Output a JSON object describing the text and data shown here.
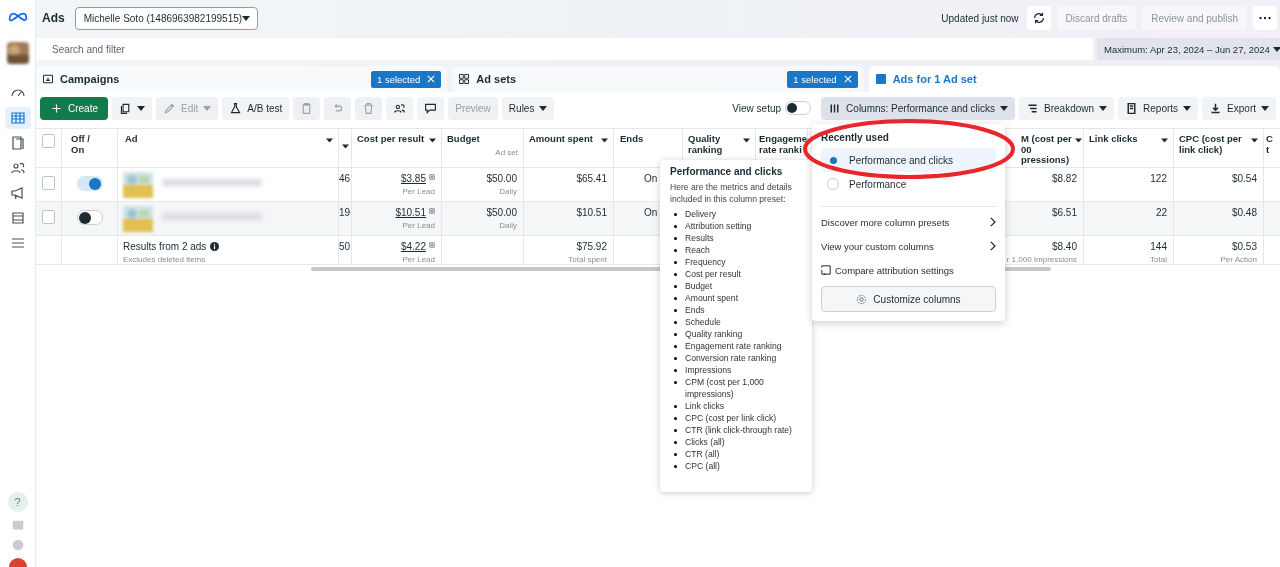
{
  "sidebar": {
    "items": [
      {
        "kind": "gauge",
        "selected": false
      },
      {
        "kind": "table",
        "selected": true
      },
      {
        "kind": "pages",
        "selected": false
      },
      {
        "kind": "people",
        "selected": false
      },
      {
        "kind": "megaphone",
        "selected": false
      },
      {
        "kind": "stack",
        "selected": false
      },
      {
        "kind": "menu",
        "selected": false
      }
    ],
    "help": "?"
  },
  "header": {
    "title": "Ads",
    "account": "Michelle Soto (1486963982199515)",
    "status": "Updated just now",
    "actions": [
      "Discard drafts",
      "Review and publish"
    ]
  },
  "search": {
    "placeholder": "Search and filter"
  },
  "date_range": "Maximum: Apr 23, 2024 – Jun 27, 2024",
  "tabs": [
    {
      "label": "Campaigns",
      "kind": "folder",
      "selected": false,
      "badge": "1 selected"
    },
    {
      "label": "Ad sets",
      "kind": "grid",
      "selected": false,
      "badge": "1 selected"
    },
    {
      "label": "Ads for 1 Ad set",
      "kind": "ad",
      "selected": true
    }
  ],
  "toolbar": {
    "left": [
      {
        "kind": "create",
        "label": "Create"
      },
      {
        "kind": "duplicate",
        "menu": true
      },
      {
        "kind": "edit",
        "label": "Edit",
        "menu": true,
        "disabled": true
      },
      {
        "kind": "abtest",
        "label": "A/B test"
      },
      {
        "kind": "clipboard",
        "disabled": true
      },
      {
        "kind": "undo",
        "disabled": true
      },
      {
        "kind": "trash",
        "disabled": true
      },
      {
        "kind": "people"
      },
      {
        "kind": "comment"
      },
      {
        "kind": "none",
        "label": "Preview",
        "disabled": true
      },
      {
        "kind": "none",
        "label": "Rules",
        "menu": true
      }
    ],
    "view_setup": {
      "label": "View setup",
      "on": false
    },
    "right": [
      {
        "kind": "columns",
        "label": "Columns: Performance and clicks",
        "menu": true,
        "selected": true
      },
      {
        "kind": "breakdown",
        "label": "Breakdown",
        "menu": true,
        "selected": false
      },
      {
        "kind": "reports",
        "label": "Reports",
        "menu": true,
        "selected": false
      },
      {
        "kind": "export",
        "label": "Export",
        "menu": true,
        "selected": false
      }
    ]
  },
  "table": {
    "select_all_checked": false,
    "select_header": "Off / On",
    "ad_header": "Ad",
    "columns": [
      {
        "menu": true
      },
      {
        "label": "Cost per result",
        "menu": true
      },
      {
        "label": "Budget",
        "sub": "Ad set"
      },
      {
        "label": "Amount spent",
        "menu": true
      },
      {
        "label": "Ends"
      },
      {
        "label": "Quality\nranking",
        "menu": true
      },
      {
        "label": "Engageme\nrate ranki"
      },
      {
        "label": "M (cost per\n00\npressions)",
        "menu": true
      },
      {
        "label": "Link clicks",
        "menu": true
      },
      {
        "label": "CPC (cost per\nlink click)",
        "menu": true
      },
      {
        "label": "C\nt"
      }
    ],
    "rows": [
      {
        "checked": false,
        "on": true,
        "cells": [
          {
            "text": "46"
          },
          {
            "text": "$3.85",
            "sub": "Per Lead",
            "attribution": true
          },
          {
            "text": "$50.00",
            "sub": "Daily"
          },
          {
            "text": "$65.41"
          },
          {
            "text": "On"
          },
          null,
          null,
          {
            "text": "$8.82"
          },
          {
            "text": "122"
          },
          {
            "text": "$0.54"
          },
          null
        ]
      },
      {
        "checked": false,
        "on": false,
        "cells": [
          {
            "text": "19"
          },
          {
            "text": "$10.51",
            "sub": "Per Lead",
            "attribution": true
          },
          {
            "text": "$50.00",
            "sub": "Daily"
          },
          {
            "text": "$10.51"
          },
          {
            "text": "On"
          },
          null,
          null,
          {
            "text": "$6.51"
          },
          {
            "text": "22"
          },
          {
            "text": "$0.48"
          },
          null
        ]
      }
    ],
    "totals": {
      "label": "Results from 2 ads",
      "note": "Excludes deleted items",
      "cells": [
        {
          "text": "50"
        },
        {
          "text": "$4.22",
          "sub": "Per Lead",
          "attribution": true
        },
        null,
        {
          "text": "$75.92",
          "sub": "Total spent"
        },
        null,
        null,
        null,
        {
          "text": "$8.40",
          "sub": "r 1,000 Impressions"
        },
        {
          "text": "144",
          "sub": "Total"
        },
        {
          "text": "$0.53",
          "sub": "Per Action"
        },
        null
      ]
    }
  },
  "preset_info": {
    "title": "Performance and clicks",
    "description": "Here are the metrics and details included in this column preset:",
    "items": [
      "Delivery",
      "Attribution setting",
      "Results",
      "Reach",
      "Frequency",
      "Cost per result",
      "Budget",
      "Amount spent",
      "Ends",
      "Schedule",
      "Quality ranking",
      "Engagement rate ranking",
      "Conversion rate ranking",
      "Impressions",
      "CPM (cost per 1,000 impressions)",
      "Link clicks",
      "CPC (cost per link click)",
      "CTR (link click-through rate)",
      "Clicks (all)",
      "CTR (all)",
      "CPC (all)"
    ]
  },
  "columns_menu": {
    "heading": "Recently used",
    "presets": [
      {
        "label": "Performance and clicks",
        "selected": true
      },
      {
        "label": "Performance",
        "selected": false
      }
    ],
    "links": [
      {
        "label": "Discover more column presets",
        "kind": "submenu"
      },
      {
        "label": "View your custom columns",
        "kind": "submenu"
      },
      {
        "label": "Compare attribution settings",
        "kind": "compare"
      }
    ],
    "customize": "Customize columns"
  }
}
